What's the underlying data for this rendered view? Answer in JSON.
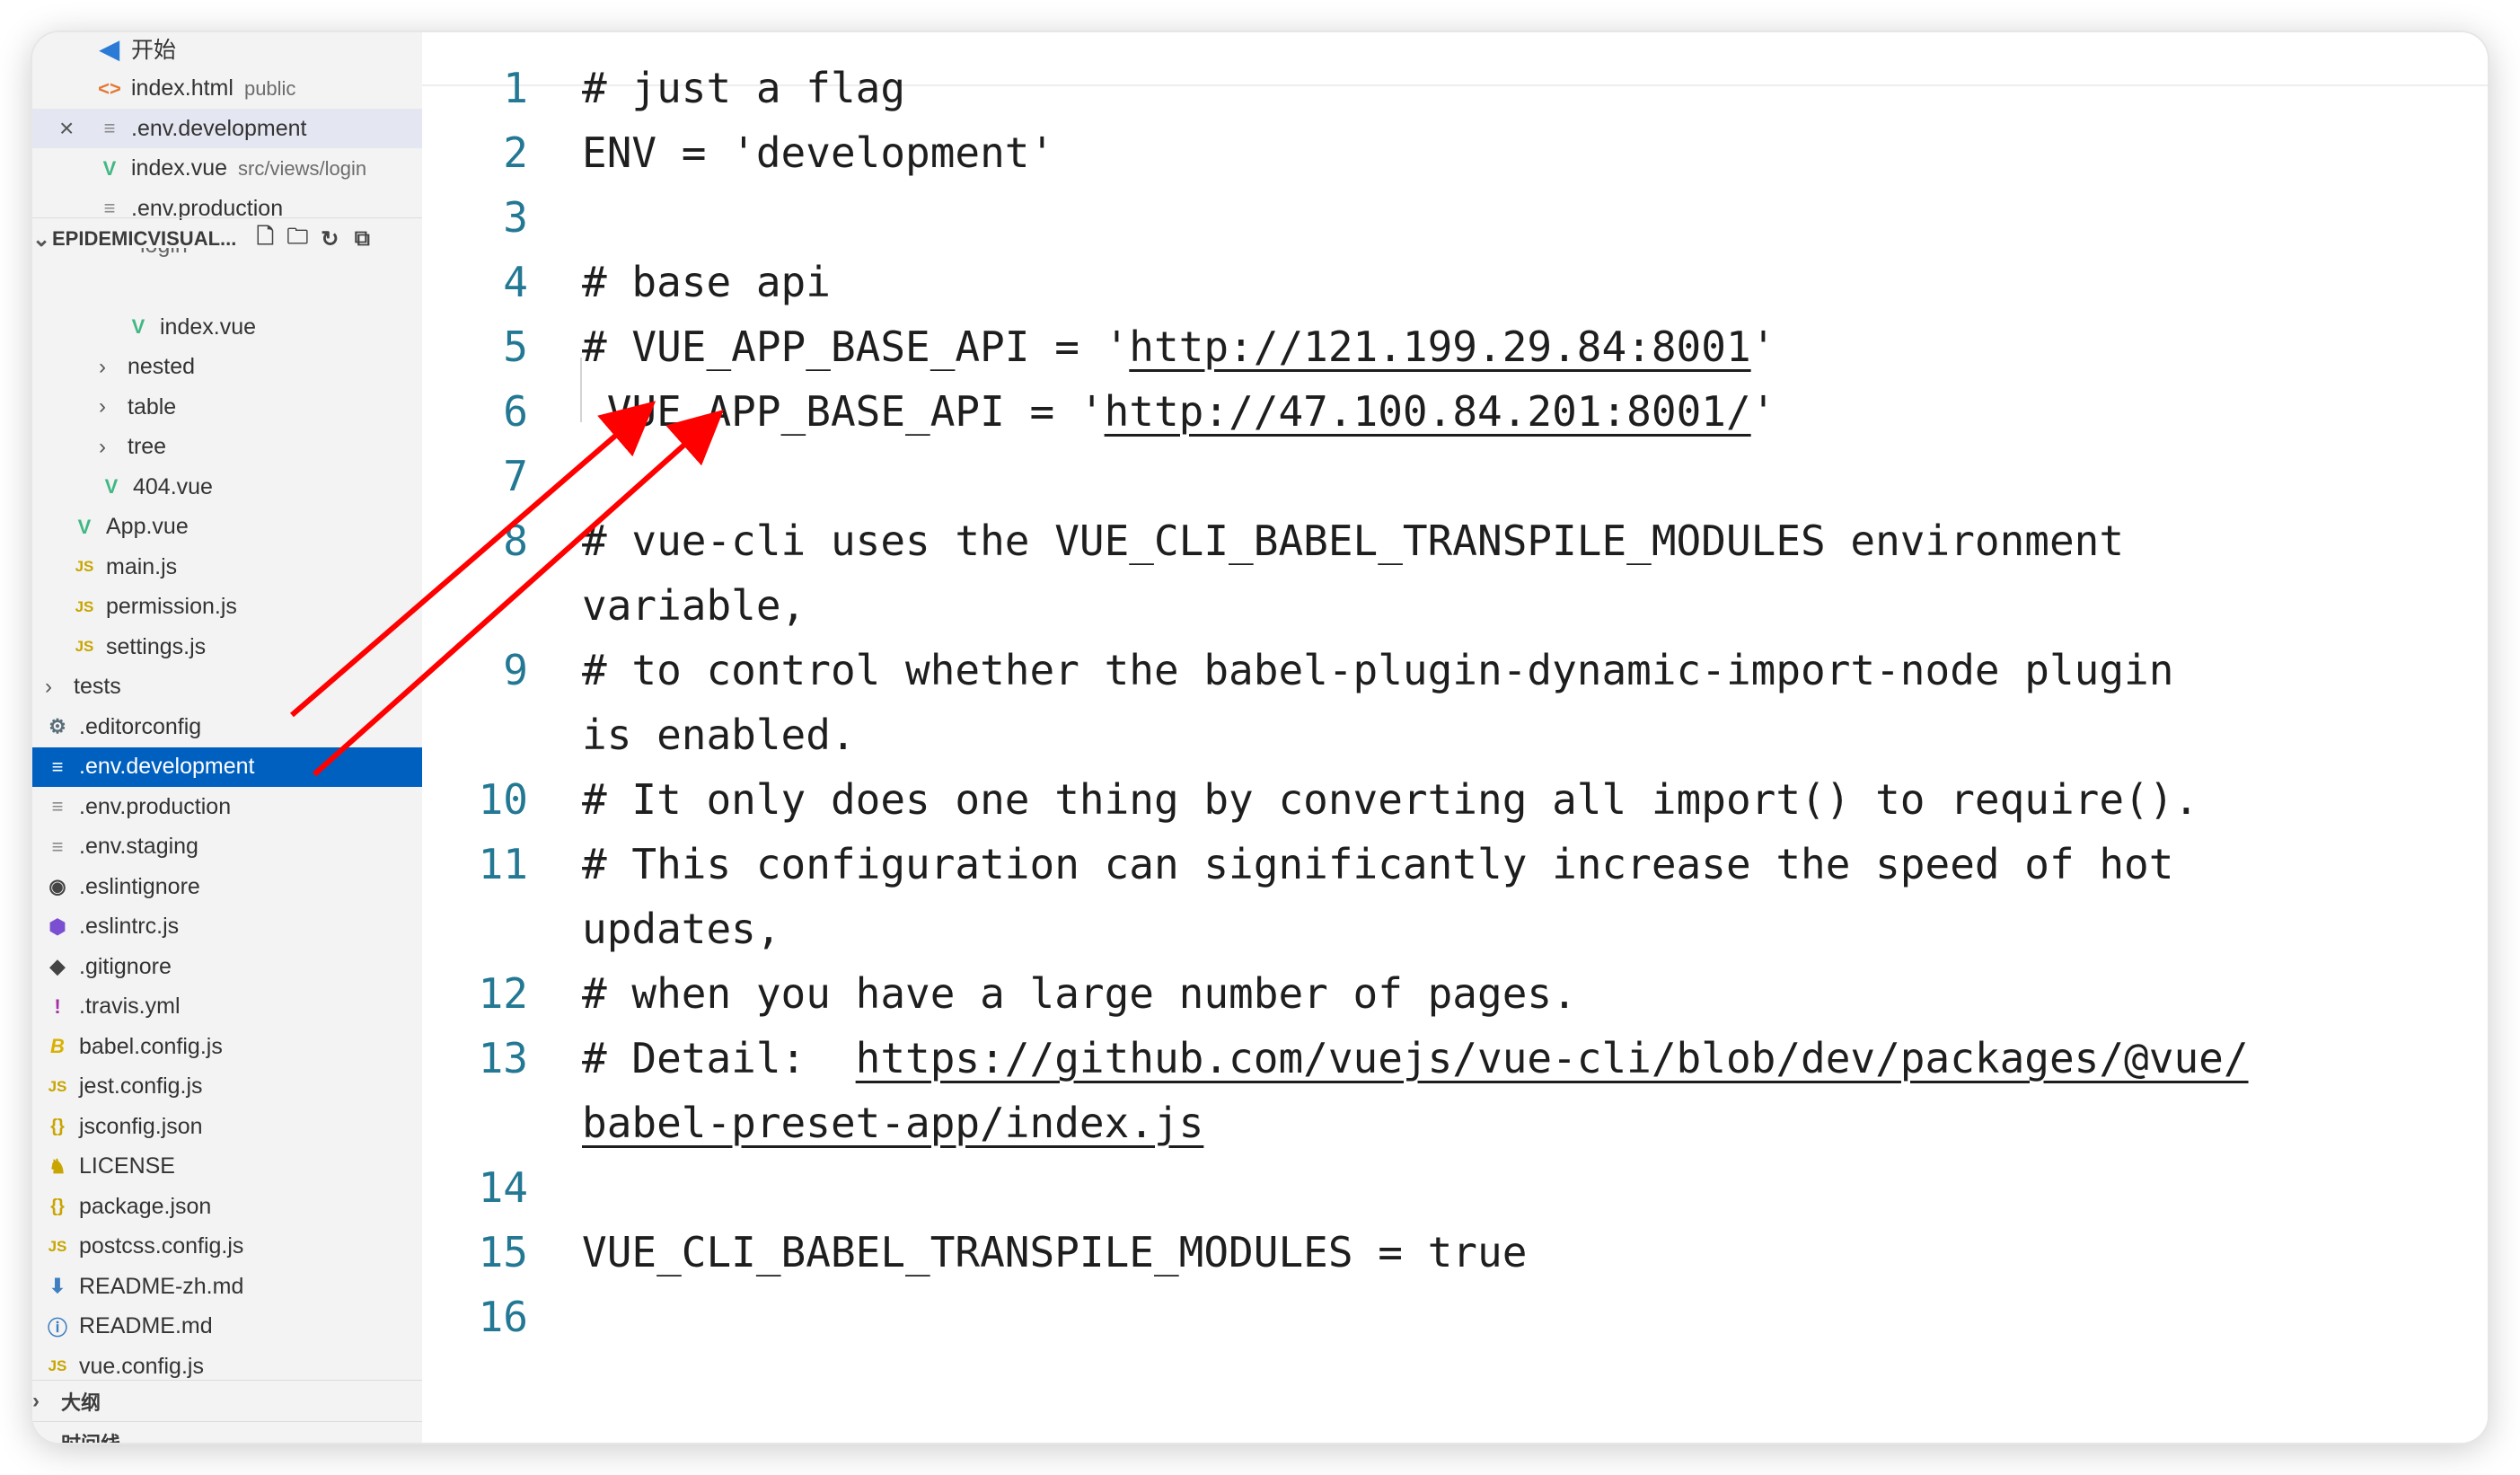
{
  "open_editors": [
    {
      "icon": "vscode-icon",
      "label": "开始",
      "desc": ""
    },
    {
      "icon": "html-icon",
      "label": "index.html",
      "desc": "public"
    },
    {
      "icon": "lines-icon",
      "label": ".env.development",
      "desc": "",
      "close": "×"
    },
    {
      "icon": "vue-icon",
      "label": "index.vue",
      "desc": "src/views/login"
    },
    {
      "icon": "lines-icon",
      "label": ".env.production",
      "desc": ""
    }
  ],
  "explorer": {
    "title": "EPIDEMICVISUAL...",
    "partial_label": "login",
    "items": [
      {
        "type": "file",
        "icon": "vue-icon",
        "label": "index.vue",
        "indent": 3
      },
      {
        "type": "folder",
        "label": "nested",
        "indent": 2
      },
      {
        "type": "folder",
        "label": "table",
        "indent": 2
      },
      {
        "type": "folder",
        "label": "tree",
        "indent": 2
      },
      {
        "type": "file",
        "icon": "vue-icon",
        "label": "404.vue",
        "indent": 2
      },
      {
        "type": "file",
        "icon": "vue-icon",
        "label": "App.vue",
        "indent": 1
      },
      {
        "type": "file",
        "icon": "js-icon",
        "label": "main.js",
        "indent": 1
      },
      {
        "type": "file",
        "icon": "js-icon",
        "label": "permission.js",
        "indent": 1
      },
      {
        "type": "file",
        "icon": "js-icon",
        "label": "settings.js",
        "indent": 1
      },
      {
        "type": "folder",
        "label": "tests",
        "indent": 0
      },
      {
        "type": "file",
        "icon": "gear-icon",
        "label": ".editorconfig",
        "indent": 0
      },
      {
        "type": "file",
        "icon": "lines-icon",
        "label": ".env.development",
        "indent": 0,
        "selected": true
      },
      {
        "type": "file",
        "icon": "lines-icon",
        "label": ".env.production",
        "indent": 0
      },
      {
        "type": "file",
        "icon": "lines-icon",
        "label": ".env.staging",
        "indent": 0
      },
      {
        "type": "file",
        "icon": "eslintignore-icon",
        "label": ".eslintignore",
        "indent": 0
      },
      {
        "type": "file",
        "icon": "eslint-icon",
        "label": ".eslintrc.js",
        "indent": 0
      },
      {
        "type": "file",
        "icon": "git-icon",
        "label": ".gitignore",
        "indent": 0
      },
      {
        "type": "file",
        "icon": "travis-icon",
        "label": ".travis.yml",
        "indent": 0
      },
      {
        "type": "file",
        "icon": "babel-icon",
        "label": "babel.config.js",
        "indent": 0
      },
      {
        "type": "file",
        "icon": "js-icon",
        "label": "jest.config.js",
        "indent": 0
      },
      {
        "type": "file",
        "icon": "json-icon",
        "label": "jsconfig.json",
        "indent": 0
      },
      {
        "type": "file",
        "icon": "license-icon",
        "label": "LICENSE",
        "indent": 0
      },
      {
        "type": "file",
        "icon": "json-icon",
        "label": "package.json",
        "indent": 0
      },
      {
        "type": "file",
        "icon": "js-icon",
        "label": "postcss.config.js",
        "indent": 0
      },
      {
        "type": "file",
        "icon": "download-icon",
        "label": "README-zh.md",
        "indent": 0
      },
      {
        "type": "file",
        "icon": "info-icon",
        "label": "README.md",
        "indent": 0
      },
      {
        "type": "file",
        "icon": "js-icon",
        "label": "vue.config.js",
        "indent": 0
      }
    ]
  },
  "sections": {
    "outline": "大纲",
    "timeline": "时间线"
  },
  "editor": {
    "lines": [
      {
        "n": "1",
        "segs": [
          {
            "t": "# just a flag"
          }
        ]
      },
      {
        "n": "2",
        "segs": [
          {
            "t": "ENV = 'development'"
          }
        ]
      },
      {
        "n": "3",
        "segs": []
      },
      {
        "n": "4",
        "segs": [
          {
            "t": "# base api"
          }
        ]
      },
      {
        "n": "5",
        "segs": [
          {
            "t": "# VUE_APP_BASE_API = '"
          },
          {
            "t": "http://121.199.29.84:8001",
            "link": true
          },
          {
            "t": "'"
          }
        ]
      },
      {
        "n": "6",
        "segs": [
          {
            "t": " VUE_APP_BASE_API = '"
          },
          {
            "t": "http://47.100.84.201:8001/",
            "link": true
          },
          {
            "t": "'"
          }
        ]
      },
      {
        "n": "7",
        "segs": []
      },
      {
        "n": "8",
        "segs": [
          {
            "t": "# vue-cli uses the VUE_CLI_BABEL_TRANSPILE_MODULES environment"
          }
        ]
      },
      {
        "n": "",
        "segs": [
          {
            "t": "variable,"
          }
        ]
      },
      {
        "n": "9",
        "segs": [
          {
            "t": "# to control whether the babel-plugin-dynamic-import-node plugin"
          }
        ]
      },
      {
        "n": "",
        "segs": [
          {
            "t": "is enabled."
          }
        ]
      },
      {
        "n": "10",
        "segs": [
          {
            "t": "# It only does one thing by converting all import() to require()."
          }
        ]
      },
      {
        "n": "11",
        "segs": [
          {
            "t": "# This configuration can significantly increase the speed of hot"
          }
        ]
      },
      {
        "n": "",
        "segs": [
          {
            "t": "updates,"
          }
        ]
      },
      {
        "n": "12",
        "segs": [
          {
            "t": "# when you have a large number of pages."
          }
        ]
      },
      {
        "n": "13",
        "segs": [
          {
            "t": "# Detail:  "
          },
          {
            "t": "https://github.com/vuejs/vue-cli/blob/dev/packages/@vue/",
            "link": true
          }
        ]
      },
      {
        "n": "",
        "segs": [
          {
            "t": "babel-preset-app/index.js",
            "link": true
          }
        ]
      },
      {
        "n": "14",
        "segs": []
      },
      {
        "n": "15",
        "segs": [
          {
            "t": "VUE_CLI_BABEL_TRANSPILE_MODULES = true"
          }
        ]
      },
      {
        "n": "16",
        "segs": []
      }
    ]
  },
  "colors": {
    "selection": "#0060c0",
    "line_number": "#237893",
    "annotation_arrow": "#ff0000"
  }
}
